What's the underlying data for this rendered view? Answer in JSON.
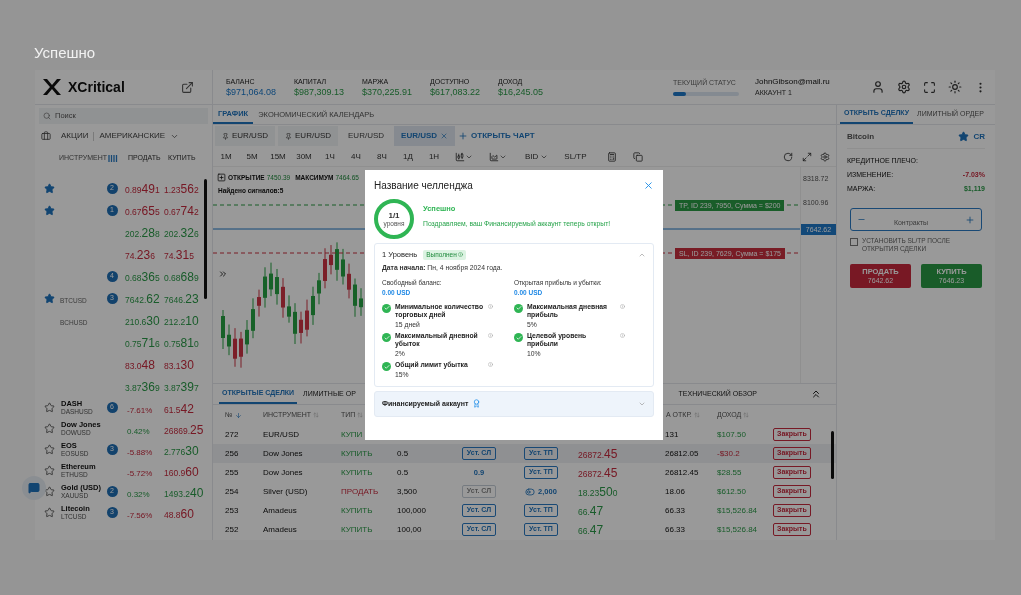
{
  "page_title": "Успешно",
  "header": {
    "brand": "XCritical",
    "stats": [
      {
        "label": "БАЛАНС",
        "value": "$971,064.08",
        "kind": "balance"
      },
      {
        "label": "КАПИТАЛ",
        "value": "$987,309.13",
        "kind": "gain"
      },
      {
        "label": "МАРЖА",
        "value": "$370,225.91",
        "kind": "gain"
      },
      {
        "label": "ДОСТУПНО",
        "value": "$617,083.22",
        "kind": "gain"
      },
      {
        "label": "ДОХОД",
        "value": "$16,245.05",
        "kind": "gain"
      }
    ],
    "status": {
      "label": "ТЕКУЩИЙ СТАТУС",
      "level": 0.2
    },
    "account": {
      "email": "JohnGibson@mail.ru",
      "name": "АККАУНТ 1"
    }
  },
  "sidebar": {
    "search": {
      "placeholder": "Поиск"
    },
    "category": {
      "group": "АКЦИИ",
      "market": "АМЕРИКАНСКИЕ"
    },
    "columns": [
      "ИНСТРУМЕНТ",
      "ПРОДАТЬ",
      "КУПИТЬ"
    ],
    "pinned_rows": [
      {
        "starred": true,
        "badge": "2",
        "sell": {
          "pre": "0.89",
          "big": "49",
          "post": "1",
          "kind": "loss"
        },
        "buy": {
          "pre": "1.23",
          "big": "56",
          "post": "2",
          "kind": "loss"
        }
      },
      {
        "starred": true,
        "badge": "1",
        "sell": {
          "pre": "0.67",
          "big": "65",
          "post": "5",
          "kind": "loss"
        },
        "buy": {
          "pre": "0.67",
          "big": "74",
          "post": "2",
          "kind": "loss"
        }
      },
      {
        "starred": false,
        "sell": {
          "pre": "202.",
          "big": "28",
          "post": "8",
          "kind": "gain"
        },
        "buy": {
          "pre": "202.",
          "big": "32",
          "post": "6",
          "kind": "gain"
        }
      },
      {
        "starred": false,
        "sell": {
          "pre": "74.",
          "big": "23",
          "post": "6",
          "kind": "loss"
        },
        "buy": {
          "pre": "74.",
          "big": "31",
          "post": "5",
          "kind": "loss"
        }
      },
      {
        "starred": false,
        "badge": "4",
        "sell": {
          "pre": "0.68",
          "big": "36",
          "post": "5",
          "kind": "gain"
        },
        "buy": {
          "pre": "0.68",
          "big": "68",
          "post": "9",
          "kind": "gain"
        }
      },
      {
        "starred": true,
        "symbol": "BTCUSD",
        "badge": "3",
        "sell": {
          "pre": "7642.",
          "big": "62",
          "kind": "gain"
        },
        "buy": {
          "pre": "7646.",
          "big": "23",
          "kind": "gain"
        }
      },
      {
        "starred": false,
        "symbol": "BCHUSD",
        "sell": {
          "pre": "210.6",
          "big": "30",
          "kind": "gain"
        },
        "buy": {
          "pre": "212.2",
          "big": "10",
          "kind": "gain"
        }
      },
      {
        "starred": false,
        "sell": {
          "pre": "0.75",
          "big": "71",
          "post": "6",
          "kind": "gain"
        },
        "buy": {
          "pre": "0.75",
          "big": "81",
          "post": "0",
          "kind": "gain"
        }
      },
      {
        "starred": false,
        "sell": {
          "pre": "83.0",
          "big": "48",
          "kind": "loss"
        },
        "buy": {
          "pre": "83.1",
          "big": "30",
          "kind": "loss"
        }
      },
      {
        "starred": false,
        "sell": {
          "pre": "3.87",
          "big": "36",
          "post": "9",
          "kind": "gain"
        },
        "buy": {
          "pre": "3.87",
          "big": "39",
          "post": "7",
          "kind": "gain"
        }
      }
    ],
    "rows": [
      {
        "name": "DASH",
        "symbol": "DASHUSD",
        "badge": "6",
        "change": {
          "text": "-7.61%",
          "kind": "loss"
        },
        "buy": {
          "pre": "61.5",
          "big": "42",
          "kind": "loss"
        }
      },
      {
        "name": "Dow Jones",
        "symbol": "DOWUSD",
        "change": {
          "text": "0.42%",
          "kind": "gain"
        },
        "buy": {
          "pre": "26869.",
          "big": "25",
          "kind": "loss"
        }
      },
      {
        "name": "EOS",
        "symbol": "EOSUSD",
        "badge": "3",
        "change": {
          "text": "-5.88%",
          "kind": "loss"
        },
        "buy": {
          "pre": "2.776",
          "big": "30",
          "kind": "gain"
        }
      },
      {
        "name": "Ethereum",
        "symbol": "ETHUSD",
        "change": {
          "text": "-5.72%",
          "kind": "loss"
        },
        "buy": {
          "pre": "160.9",
          "big": "60",
          "kind": "loss"
        }
      },
      {
        "name": "Gold (USD)",
        "symbol": "XAUUSD",
        "badge": "2",
        "change": {
          "text": "0.32%",
          "kind": "gain"
        },
        "buy": {
          "pre": "1493.2",
          "big": "40",
          "kind": "gain"
        }
      },
      {
        "name": "Litecoin",
        "symbol": "LTCUSD",
        "badge": "3",
        "change": {
          "text": "-7.56%",
          "kind": "loss"
        },
        "buy": {
          "pre": "48.8",
          "big": "60",
          "kind": "loss"
        }
      }
    ]
  },
  "main_tabs": [
    {
      "label": "ГРАФИК",
      "selected": true
    },
    {
      "label": "ЭКОНОМИЧЕСКИЙ КАЛЕНДАРЬ",
      "selected": false
    }
  ],
  "chart_tabs": [
    {
      "label": "EUR/USD",
      "pinned": true,
      "selected": false
    },
    {
      "label": "EUR/USD",
      "pinned": true,
      "selected": false
    },
    {
      "label": "EUR/USD",
      "pinned": false,
      "selected": false
    },
    {
      "label": "EUR/USD",
      "pinned": false,
      "selected": true
    }
  ],
  "open_chart": "ОТКРЫТЬ ЧАРТ",
  "toolbar": {
    "intervals": [
      "1M",
      "5M",
      "15M",
      "30M",
      "1Ч",
      "4Ч",
      "8Ч",
      "1Д",
      "1Н"
    ],
    "price_source": "BID",
    "sltp": "SL/TP"
  },
  "chart": {
    "ohlc": [
      {
        "label": "ОТКРЫТИЕ",
        "value": "7450.39"
      },
      {
        "label": "МАКСИМУМ",
        "value": "7464.65"
      }
    ],
    "signals": "Найдено сигналов:5",
    "price_labels": [
      "8318.72",
      "8100.96"
    ],
    "lines": [
      {
        "kind": "tp",
        "text": "TP, ID 239, 7950, Сумма = $200"
      },
      {
        "kind": "current",
        "text": "7642.62"
      },
      {
        "kind": "sl",
        "text": "SL, ID 239, 7629, Сумма = $175"
      }
    ]
  },
  "bottom_tabs": [
    {
      "label": "ОТКРЫТЫЕ СДЕЛКИ",
      "selected": true
    },
    {
      "label": "ЛИМИТНЫЕ ОР",
      "selected": false
    },
    {
      "label": "ТЕХНИЧЕСКИЙ ОБЗОР",
      "selected": false
    }
  ],
  "table": {
    "columns": [
      {
        "label": "№",
        "active": true
      },
      {
        "label": "ИНСТРУМЕНТ",
        "active": false
      },
      {
        "label": "ТИП",
        "active": false
      },
      {
        "label": "А ОТКР.",
        "active": false
      },
      {
        "label": "ДОХОД",
        "active": false
      }
    ],
    "rows": [
      {
        "selected": false,
        "id": "272",
        "instrument": "EUR/USD",
        "type": {
          "text": "КУПИ",
          "kind": "gain"
        },
        "entry": "131",
        "pnl": {
          "text": "$107.50",
          "kind": "gain"
        },
        "close": "Закрыть"
      },
      {
        "selected": true,
        "id": "256",
        "instrument": "Dow Jones",
        "type": {
          "text": "КУПИТЬ",
          "kind": "gain"
        },
        "amount": "0.5",
        "sl": {
          "kind": "button",
          "text": "Уст. СЛ"
        },
        "tp": {
          "kind": "button",
          "text": "Уст. ТП"
        },
        "price": {
          "pre": "26872.",
          "big": "45",
          "kind": "loss"
        },
        "entry": "26812.05",
        "pnl": {
          "text": "-$30.2",
          "kind": "loss"
        },
        "close": "Закрыть"
      },
      {
        "selected": false,
        "id": "255",
        "instrument": "Dow Jones",
        "type": {
          "text": "КУПИТЬ",
          "kind": "gain"
        },
        "amount": "0.5",
        "sl": {
          "kind": "value",
          "text": "0.9"
        },
        "tp": {
          "kind": "button",
          "text": "Уст. ТП"
        },
        "price": {
          "pre": "26872.",
          "big": "45",
          "kind": "loss"
        },
        "entry": "26812.45",
        "pnl": {
          "text": "$28.55",
          "kind": "gain"
        },
        "close": "Закрыть"
      },
      {
        "selected": false,
        "id": "254",
        "instrument": "Silver (USD)",
        "type": {
          "text": "ПРОДАТЬ",
          "kind": "loss"
        },
        "amount": "3,500",
        "sl": {
          "kind": "disabled",
          "text": "Уст. СЛ"
        },
        "tp": {
          "kind": "toggle",
          "text": "2,000"
        },
        "price": {
          "pre": "18.23",
          "big": "50",
          "post": "0",
          "kind": "gain"
        },
        "entry": "18.06",
        "pnl": {
          "text": "$612.50",
          "kind": "gain"
        },
        "close": "Закрыть"
      },
      {
        "selected": false,
        "id": "253",
        "instrument": "Amadeus",
        "type": {
          "text": "КУПИТЬ",
          "kind": "gain"
        },
        "amount": "100,000",
        "sl": {
          "kind": "button",
          "text": "Уст. СЛ"
        },
        "tp": {
          "kind": "button",
          "text": "Уст. ТП"
        },
        "price": {
          "pre": "66.",
          "big": "47",
          "kind": "gain"
        },
        "entry": "66.33",
        "pnl": {
          "text": "$15,526.84",
          "kind": "gain"
        },
        "close": "Закрыть"
      },
      {
        "selected": false,
        "id": "252",
        "instrument": "Amadeus",
        "type": {
          "text": "КУПИТЬ",
          "kind": "gain"
        },
        "amount": "100,00",
        "sl": {
          "kind": "button",
          "text": "Уст. СЛ"
        },
        "tp": {
          "kind": "button",
          "text": "Уст. ТП"
        },
        "price": {
          "pre": "66.",
          "big": "47",
          "kind": "gain"
        },
        "entry": "66.33",
        "pnl": {
          "text": "$15,526.84",
          "kind": "gain"
        },
        "close": "Закрыть"
      }
    ]
  },
  "trade_panel": {
    "tabs": [
      {
        "label": "ОТКРЫТЬ СДЕЛКУ",
        "selected": true
      },
      {
        "label": "ЛИМИТНЫЙ ОРДЕР",
        "selected": false
      }
    ],
    "instrument": "Bitcoin",
    "favorite": true,
    "code": "CR",
    "fields": [
      {
        "label": "КРЕДИТНОЕ ПЛЕЧО:"
      },
      {
        "label": "ИЗМЕНЕНИЕ:",
        "value": "-7.03%",
        "kind": "loss"
      },
      {
        "label": "МАРЖА:",
        "value": "$1,119",
        "kind": "gain"
      }
    ],
    "stepper": {
      "placeholder": "Контракты"
    },
    "sltp": {
      "label": "УСТАНОВИТЬ SL/TP ПОСЛЕ ОТКРЫТИЯ СДЕЛКИ",
      "checked": false
    },
    "sell": {
      "label": "ПРОДАТЬ",
      "price": "7642.62"
    },
    "buy": {
      "label": "КУПИТЬ",
      "price": "7646.23"
    }
  },
  "modal": {
    "title": "Название челленджа",
    "progress": "1/1",
    "progress_unit": "уровня",
    "status": "Успешно",
    "message": "Поздравляем, ваш Финансируемый аккаунт теперь открыт!",
    "sections": [
      {
        "title": "1 Уровень",
        "badge": "Выполнен",
        "expanded": true,
        "start": "**Дата начала:** Пн, 4 ноября 2024 года.",
        "balances": [
          {
            "label": "Свободный баланс:",
            "value": "0.00 USD"
          },
          {
            "label": "Открытая прибыль и убытки:",
            "value": "0.00 USD"
          }
        ],
        "criteria": [
          {
            "label": "Минимальное количество торговых дней",
            "value": "15 дней",
            "met": true
          },
          {
            "label": "Максимальная дневная прибыль",
            "value": "5%",
            "met": true
          },
          {
            "label": "Максимальный дневной убыток",
            "value": "2%",
            "met": true
          },
          {
            "label": "Целевой уровень прибыли",
            "value": "10%",
            "met": true
          },
          {
            "label": "Общий лимит убытка",
            "value": "15%",
            "met": true
          }
        ]
      },
      {
        "title": "Финансируемый аккаунт",
        "expanded": false
      }
    ]
  }
}
